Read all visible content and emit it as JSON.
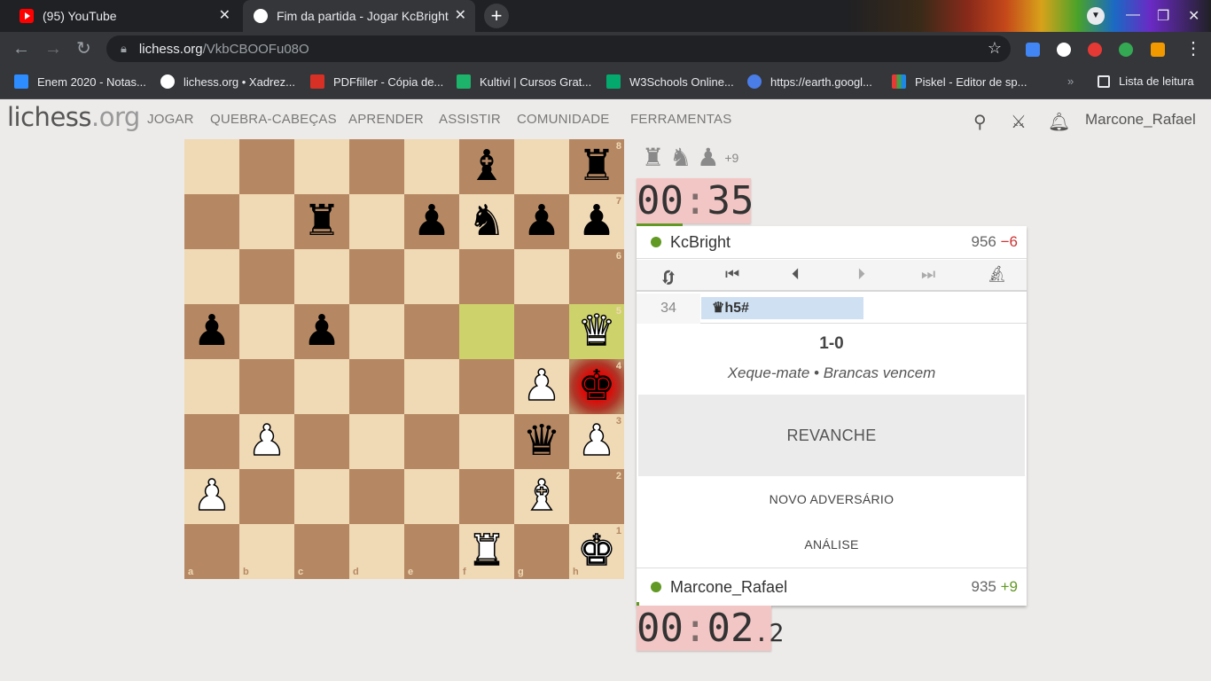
{
  "browser": {
    "tabs": [
      {
        "title": "(95) YouTube"
      },
      {
        "title": "Fim da partida - Jogar KcBright • lichess.org"
      }
    ],
    "url_host": "lichess.org",
    "url_path": "/VkbCBOOFu08O",
    "bookmarks": [
      {
        "label": "Enem 2020 - Notas..."
      },
      {
        "label": "lichess.org • Xadrez..."
      },
      {
        "label": "PDFfiller - Cópia de..."
      },
      {
        "label": "Kultivi | Cursos Grat..."
      },
      {
        "label": "W3Schools Online..."
      },
      {
        "label": "https://earth.googl..."
      },
      {
        "label": "Piskel - Editor de sp..."
      }
    ],
    "reading_list": "Lista de leitura",
    "more_bookmarks": "»"
  },
  "site": {
    "logo_main": "lichess",
    "logo_tld": ".org",
    "nav": [
      "JOGAR",
      "QUEBRA-CABEÇAS",
      "APRENDER",
      "ASSISTIR",
      "COMUNIDADE",
      "FERRAMENTAS"
    ],
    "username": "Marcone_Rafael"
  },
  "board": {
    "ranks": [
      "8",
      "7",
      "6",
      "5",
      "4",
      "3",
      "2",
      "1"
    ],
    "files": [
      "a",
      "b",
      "c",
      "d",
      "e",
      "f",
      "g",
      "h"
    ],
    "rows": [
      [
        "",
        "",
        "",
        "",
        "",
        "♝",
        "",
        "♜"
      ],
      [
        "",
        "",
        "♜",
        "",
        "♟",
        "♞",
        "♟",
        "♟"
      ],
      [
        "",
        "",
        "",
        "",
        "",
        "",
        "",
        ""
      ],
      [
        "♟",
        "",
        "♟",
        "",
        "",
        "",
        "",
        "♕"
      ],
      [
        "",
        "",
        "",
        "",
        "",
        "",
        "♙",
        "♚"
      ],
      [
        "",
        "♙",
        "",
        "",
        "",
        "",
        "♛",
        "♙"
      ],
      [
        "♙",
        "",
        "",
        "",
        "",
        "",
        "♗",
        ""
      ],
      [
        "",
        "",
        "",
        "",
        "",
        "♖",
        "",
        "♔"
      ]
    ],
    "last_move": [
      "f5",
      "h5"
    ],
    "in_check": "h4"
  },
  "game": {
    "material_pieces": [
      "♜",
      "♞",
      "♟"
    ],
    "material_diff": "+9",
    "top_clock": {
      "min": "00",
      "sep": ":",
      "sec": "35"
    },
    "bottom_clock": {
      "min": "00",
      "sep": ":",
      "sec": "02",
      "tenths": ".2"
    },
    "top_player": {
      "name": "KcBright",
      "rating": "956",
      "diff": "−6"
    },
    "bottom_player": {
      "name": "Marcone_Rafael",
      "rating": "935",
      "diff": "+9"
    },
    "move_number": "34",
    "move_san": "♛h5#",
    "score": "1-0",
    "status": "Xeque-mate • Brancas vencem",
    "rematch": "REVANCHE",
    "new_opponent": "NOVO ADVERSÁRIO",
    "analysis": "ANÁLISE"
  }
}
